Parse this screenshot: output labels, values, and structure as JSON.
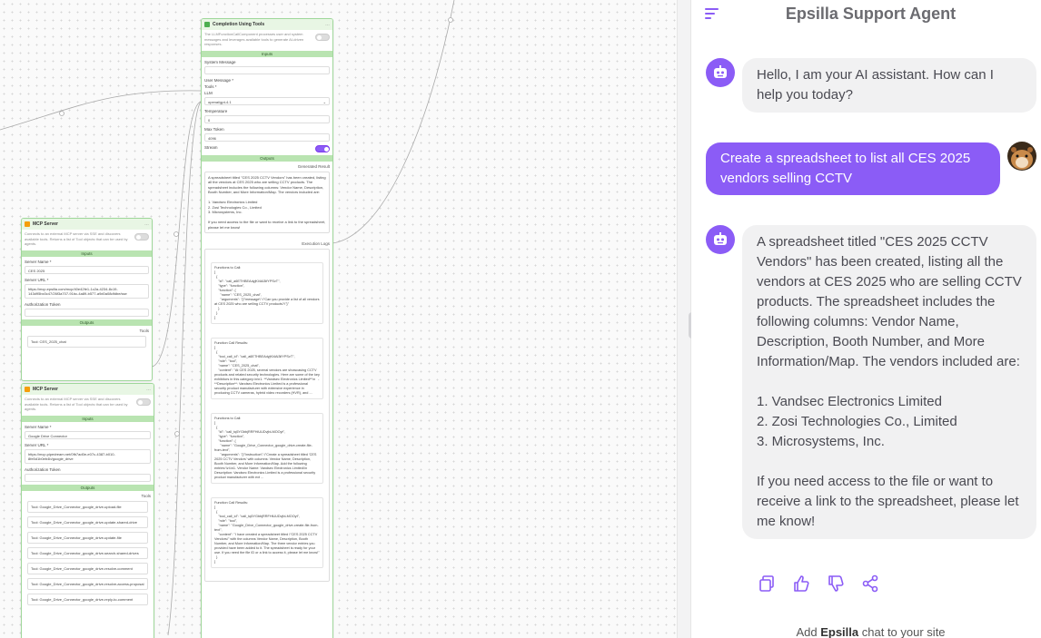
{
  "chat": {
    "title": "Epsilla Support Agent",
    "messages": [
      {
        "role": "assistant",
        "text": "Hello, I am your AI assistant. How can I help you today?"
      },
      {
        "role": "user",
        "text": "Create a spreadsheet to list all CES 2025 vendors selling CCTV"
      },
      {
        "role": "assistant",
        "text": "A spreadsheet titled \"CES 2025 CCTV Vendors\" has been created, listing all the vendors at CES 2025 who are selling CCTV products. The spreadsheet includes the following columns: Vendor Name, Description, Booth Number, and More Information/Map. The vendors included are:\n\n1. Vandsec Electronics Limited\n2. Zosi Technologies Co., Limited\n3. Microsystems, Inc.\n\nIf you need access to the file or want to receive a link to the spreadsheet, please let me know!"
      }
    ],
    "footer_prefix": "Add",
    "footer_brand": "Epsilla",
    "footer_suffix": "chat to your site"
  },
  "completion_node": {
    "title": "Completion Using Tools",
    "description": "The LLMFunctionCallComponent processes user and system messages and leverages available tools to generate AI-driven responses.",
    "inputs_label": "Inputs",
    "system_message_label": "System Message",
    "user_message_label": "User Message *",
    "tools_label": "Tools *",
    "llm_label": "LLM",
    "llm_value": "openai/gpt-4.1",
    "temperature_label": "Temperature",
    "temperature_value": "0",
    "max_token_label": "Max Token",
    "max_token_value": "4096",
    "stream_label": "Stream",
    "outputs_label": "Outputs",
    "generated_result_label": "Generated Result",
    "generated_result": "A spreadsheet titled \"CES 2025 CCTV Vendors\" has been created, listing all the vendors at CES 2025 who are selling CCTV products. The spreadsheet includes the following columns: Vendor Name, Description, Booth Number, and More Information/Map. The vendors included are:\n\n1. Vandsec Electronics Limited\n2. Zosi Technologies Co., Limited\n3. Microsystems, Inc.\n\nIf you need access to the file or want to receive a link to the spreadsheet, please let me know!",
    "execution_logs_label": "Execution Logs",
    "logs": [
      "Functions to Call:\n[\n  {\n    \"id\": \"call_a6ETHBEAdyjKl4Ai3ifYPSvT\",\n    \"type\": \"function\",\n    \"function\": {\n      \"name\": \"CES_2025_chat\",\n      \"arguments\": \"{\\\"message\\\":\\\"Can you provide a list of all vendors at CES 2025 who are selling CCTV products?\\\"}\"\n    }\n  }\n]",
      "Function Call Results:\n[\n  {\n    \"tool_call_id\": \"call_a6ETHBEAdyjKl4Ai3ifYPSvT\",\n    \"role\": \"tool\",\n    \"name\": \"CES_2025_chat\",\n    \"content\": \"At CES 2025, several vendors are showcasing CCTV products and related security technologies. Here are some of the key exhibitors in this category:\\n\\n1. **Vandsec Electronics Limited**\\n   - **Description**: Vandsec Electronics Limited is a professional security product manufacturer with extensive experience in producing CCTV cameras, hybrid video recorders (HVR), and ...",
      "Functions to Call:\n[\n  {\n    \"id\": \"call_tq5YGbbjRRFHiUUDvjbLMOOyt\",\n    \"type\": \"function\",\n    \"function\": {\n      \"name\": \"Google_Drive_Connector_google_drive-create-file-from-text\",\n      \"arguments\": \"{\\\"instruction\\\":\\\"Create a spreadsheet titled 'CES 2025 CCTV Vendors' with columns: Vendor Name, Description, Booth Number, and More Information/Map. Add the following entries:\\\\n\\\\n1. Vendor Name: Vandsec Electronics Limited\\\\n   Description: Vandsec Electronics Limited is a professional security product manufacturer with ext ...",
      "Function Call Results:\n[\n  {\n    \"tool_call_id\": \"call_tq5YGbbjRRFHiUUDvjbLMOOyt\",\n    \"role\": \"tool\",\n    \"name\": \"Google_Drive_Connector_google_drive-create-file-from-text\",\n    \"content\": \"I have created a spreadsheet titled \\\"CES 2025 CCTV Vendors\\\" with the columns Vendor Name, Description, Booth Number, and More Information/Map. The three vendor entries you provided have been added to it. The spreadsheet is ready for your use. If you need the file ID or a link to access it, please let me know!\"\n  }\n]"
    ]
  },
  "mcp_server_1": {
    "title": "MCP Server",
    "description": "Connects to an external MCP server via SSE and discovers available tools. Returns a list of Tool objects that can be used by agents.",
    "inputs_label": "Inputs",
    "server_name_label": "Server Name *",
    "server_name": "CES 2025",
    "server_url_label": "Server URL *",
    "server_url": "https://mcp.epsilla.com/mcp/40e42fe1-1c2a-4234-8c19-143d95bc0c47/26f3a707-91bc-4a89-b577-a9d0a08dfdbe/sse",
    "auth_token_label": "Authorization Token",
    "outputs_label": "Outputs",
    "tools_label": "Tools",
    "tools": [
      "Tool: CES_2025_chat"
    ]
  },
  "mcp_server_2": {
    "title": "MCP Server",
    "description": "Connects to an external MCP server via SSE and discovers available tools. Returns a list of Tool objects that can be used by agents.",
    "inputs_label": "Inputs",
    "server_name_label": "Server Name *",
    "server_name": "Google Drive Connector",
    "server_url_label": "Server URL *",
    "server_url": "https://mcp.pipedream.net/0fb7ad0e-e07c-4387-b010-8fe5d1b0eb4b/google_drive",
    "auth_token_label": "Authorization Token",
    "outputs_label": "Outputs",
    "tools_label": "Tools",
    "tools": [
      "Tool: Google_Drive_Connector_google_drive-upload-file",
      "Tool: Google_Drive_Connector_google_drive-update-shared-drive",
      "Tool: Google_Drive_Connector_google_drive-update-file",
      "Tool: Google_Drive_Connector_google_drive-search-shared-drives",
      "Tool: Google_Drive_Connector_google_drive-resolve-comment",
      "Tool: Google_Drive_Connector_google_drive-resolve-access-proposal",
      "Tool: Google_Drive_Connector_google_drive-reply-to-comment"
    ]
  },
  "colors": {
    "accent": "#8b5cf6",
    "node_border": "#9fd79a",
    "node_bar": "#b9e4b1"
  }
}
